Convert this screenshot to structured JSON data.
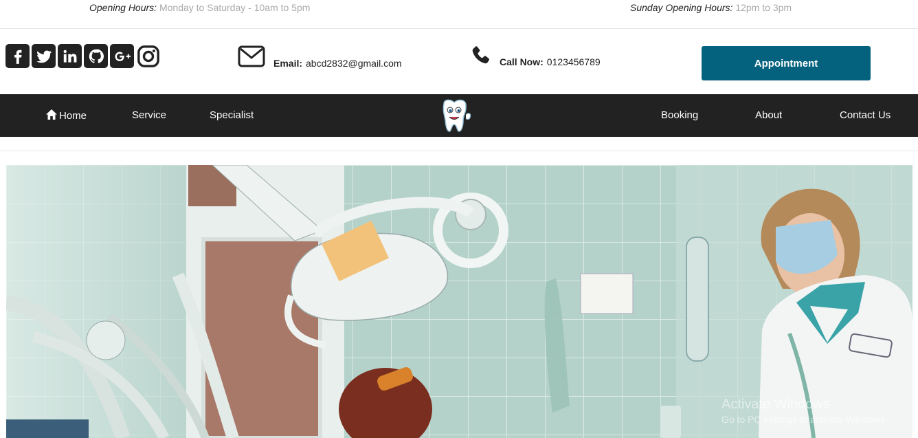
{
  "topbar": {
    "weekday_label": "Opening Hours:",
    "weekday_value": "Monday to Saturday - 10am to 5pm",
    "sunday_label": "Sunday Opening Hours:",
    "sunday_value": "12pm to 3pm"
  },
  "socials": [
    "facebook-icon",
    "twitter-icon",
    "linkedin-icon",
    "github-icon",
    "google-plus-icon",
    "instagram-icon"
  ],
  "contact": {
    "email_label": "Email:",
    "email_value": "abcd2832@gmail.com",
    "phone_label": "Call Now:",
    "phone_value": "0123456789"
  },
  "appointment_label": "Appointment",
  "nav": {
    "home": "Home",
    "service": "Service",
    "specialist": "Specialist",
    "booking": "Booking",
    "about": "About",
    "contact": "Contact Us"
  },
  "watermark": {
    "line1": "Activate Windows",
    "line2": "Go to PC settings to activate Windows."
  },
  "colors": {
    "accent": "#05627e",
    "nav_bg": "#222222"
  }
}
